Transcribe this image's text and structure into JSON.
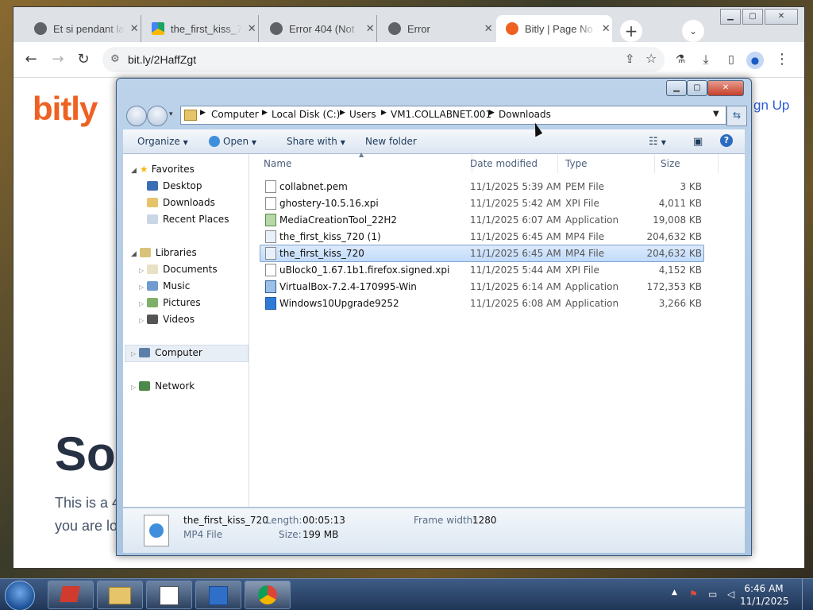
{
  "browser": {
    "tabs": [
      {
        "title": "Et si pendant la",
        "favicon": "globe-icon"
      },
      {
        "title": "the_first_kiss_7",
        "favicon": "google-drive-icon"
      },
      {
        "title": "Error 404 (Not",
        "favicon": "globe-icon"
      },
      {
        "title": "Error",
        "favicon": "globe-icon"
      },
      {
        "title": "Bitly | Page No",
        "favicon": "bitly-icon"
      }
    ],
    "url": "bit.ly/2HaffZgt"
  },
  "bitly_page": {
    "logo": "bitly",
    "sign_up": "gn Up",
    "heading": "Sor",
    "line1": "This is a 4",
    "line2": "you are lo",
    "colors": {
      "brand": "#ee6123",
      "link": "#2a5bd7"
    }
  },
  "explorer": {
    "breadcrumb": [
      "Computer",
      "Local Disk (C:)",
      "Users",
      "VM1.COLLABNET.001",
      "Downloads"
    ],
    "commands": {
      "organize": "Organize",
      "open": "Open",
      "share_with": "Share with",
      "new_folder": "New folder"
    },
    "nav": {
      "favorites": "Favorites",
      "desktop": "Desktop",
      "downloads": "Downloads",
      "recent_places": "Recent Places",
      "libraries": "Libraries",
      "documents": "Documents",
      "music": "Music",
      "pictures": "Pictures",
      "videos": "Videos",
      "computer": "Computer",
      "network": "Network"
    },
    "columns": {
      "name": "Name",
      "date": "Date modified",
      "type": "Type",
      "size": "Size"
    },
    "files": [
      {
        "name": "collabnet.pem",
        "date": "11/1/2025 5:39 AM",
        "type": "PEM File",
        "size": "3 KB",
        "icon": "file-icon"
      },
      {
        "name": "ghostery-10.5.16.xpi",
        "date": "11/1/2025 5:42 AM",
        "type": "XPI File",
        "size": "4,011 KB",
        "icon": "file-icon"
      },
      {
        "name": "MediaCreationTool_22H2",
        "date": "11/1/2025 6:07 AM",
        "type": "Application",
        "size": "19,008 KB",
        "icon": "app-icon"
      },
      {
        "name": "the_first_kiss_720 (1)",
        "date": "11/1/2025 6:45 AM",
        "type": "MP4 File",
        "size": "204,632 KB",
        "icon": "video-file-icon"
      },
      {
        "name": "the_first_kiss_720",
        "date": "11/1/2025 6:45 AM",
        "type": "MP4 File",
        "size": "204,632 KB",
        "icon": "video-file-icon",
        "selected": true
      },
      {
        "name": "uBlock0_1.67.1b1.firefox.signed.xpi",
        "date": "11/1/2025 5:44 AM",
        "type": "XPI File",
        "size": "4,152 KB",
        "icon": "file-icon"
      },
      {
        "name": "VirtualBox-7.2.4-170995-Win",
        "date": "11/1/2025 6:14 AM",
        "type": "Application",
        "size": "172,353 KB",
        "icon": "virtualbox-icon"
      },
      {
        "name": "Windows10Upgrade9252",
        "date": "11/1/2025 6:08 AM",
        "type": "Application",
        "size": "3,266 KB",
        "icon": "windows-icon"
      }
    ],
    "details": {
      "name": "the_first_kiss_720",
      "type": "MP4 File",
      "length_label": "Length:",
      "length": "00:05:13",
      "size_label": "Size:",
      "size": "199 MB",
      "frame_width_label": "Frame width:",
      "frame_width": "1280"
    }
  },
  "taskbar": {
    "time": "6:46 AM",
    "date": "11/1/2025"
  }
}
